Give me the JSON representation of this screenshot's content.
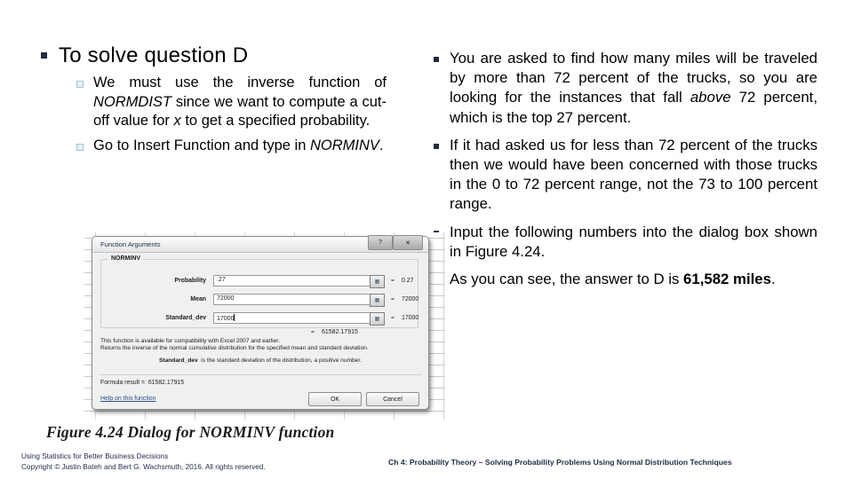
{
  "slide": {
    "left_column": {
      "heading": "To solve question D",
      "sub_bullets": [
        {
          "segments": [
            {
              "text": "We must use the inverse function of ",
              "style": "normal"
            },
            {
              "text": "NORMDIST",
              "style": "italic"
            },
            {
              "text": " since we want to compute a cut-off value for ",
              "style": "normal"
            },
            {
              "text": "x",
              "style": "italic"
            },
            {
              "text": " to get a specified probability.",
              "style": "normal"
            }
          ]
        },
        {
          "segments": [
            {
              "text": "Go to Insert Function and type in ",
              "style": "normal"
            },
            {
              "text": "NORMINV",
              "style": "italic"
            },
            {
              "text": ".",
              "style": "normal"
            }
          ]
        }
      ]
    },
    "right_column": {
      "bullets": [
        {
          "segments": [
            {
              "text": "You are asked to find how many miles will be traveled by more than 72 percent of the trucks, so you are looking for the instances that fall ",
              "style": "normal"
            },
            {
              "text": "above",
              "style": "italic"
            },
            {
              "text": " 72 percent, which is the top 27 percent.",
              "style": "normal"
            }
          ]
        },
        {
          "segments": [
            {
              "text": "If it had asked us for less than 72 percent of the trucks then we would have been concerned with those trucks in the 0 to 72 percent range, not the 73 to 100 percent range.",
              "style": "normal"
            }
          ]
        },
        {
          "segments": [
            {
              "text": "Input the following numbers into the dialog box shown in Figure 4.24.",
              "style": "normal"
            }
          ]
        },
        {
          "segments": [
            {
              "text": "As you can see, the answer to D is ",
              "style": "normal"
            },
            {
              "text": "61,582 miles",
              "style": "bold"
            },
            {
              "text": ".",
              "style": "normal"
            }
          ]
        }
      ]
    },
    "caption": "Figure 4.24  Dialog for NORMINV function",
    "footer_left_line1": "Using Statistics for Better Business Decisions",
    "footer_left_line2": "Copyright © Justin Bateh and Bert G. Wachsmuth, 2016. All rights reserved.",
    "footer_right": "Ch 4: Probability Theory – Solving Probability Problems Using Normal Distribution Techniques"
  },
  "dialog": {
    "title": "Function Arguments",
    "help_button_icon": "question-mark-icon",
    "close_button_icon": "close-x-icon",
    "function_name": "NORMINV",
    "arguments": [
      {
        "label": "Probability",
        "value": ".27",
        "equals": "=",
        "result": "0.27",
        "picker_icon": "range-selector-icon"
      },
      {
        "label": "Mean",
        "value": "72000",
        "equals": "=",
        "result": "72000",
        "picker_icon": "range-selector-icon"
      },
      {
        "label": "Standard_dev",
        "value": "17000",
        "equals": "=",
        "result": "17000",
        "picker_icon": "range-selector-icon"
      }
    ],
    "result_equals": "=",
    "result_value": "61582.17915",
    "description_line1": "This function is available for compatibility with Excel 2007 and earlier.",
    "description_line2": "Returns the inverse of the normal cumulative distribution for the specified mean and standard deviation.",
    "arg_help_name": "Standard_dev",
    "arg_help_text": "is the standard deviation of the distribution, a positive number.",
    "formula_result_label": "Formula result =",
    "formula_result_value": "61582.17915",
    "help_link": "Help on this function",
    "ok_label": "OK",
    "cancel_label": "Cancel"
  },
  "colors": {
    "bullet_dark": "#262a40",
    "bullet_light_fill": "#e7f1f7",
    "bullet_light_border": "#9fc4d8",
    "footer_text": "#1f2a44",
    "dialog_face": "#f0f0f0",
    "link": "#2a4b8d"
  }
}
